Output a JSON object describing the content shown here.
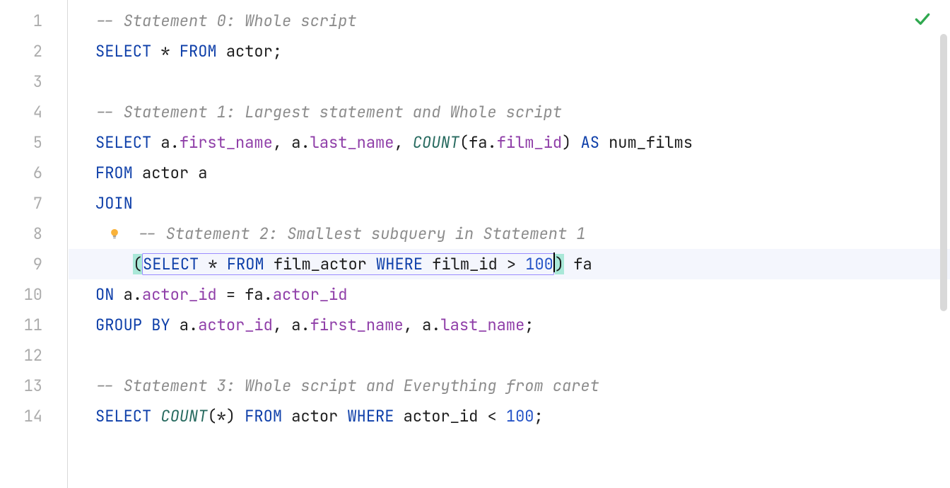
{
  "editor": {
    "line_numbers": [
      "1",
      "2",
      "3",
      "4",
      "5",
      "6",
      "7",
      "8",
      "9",
      "10",
      "11",
      "12",
      "13",
      "14"
    ],
    "highlighted_line_index": 8,
    "status_icon": "check-ok",
    "bulb_icon": "intention-bulb"
  },
  "code": {
    "l1_comment": "-- Statement 0: Whole script",
    "l2_select": "SELECT",
    "l2_star": " * ",
    "l2_from": "FROM",
    "l2_actor": " actor",
    "l2_semi": ";",
    "l4_comment": "-- Statement 1: Largest statement and Whole script",
    "l5_select": "SELECT",
    "l5_a1": " a",
    "l5_dot1": ".",
    "l5_first": "first_name",
    "l5_comma1": ", ",
    "l5_a2": "a",
    "l5_dot2": ".",
    "l5_last": "last_name",
    "l5_comma2": ", ",
    "l5_count": "COUNT",
    "l5_open": "(",
    "l5_fa": "fa",
    "l5_dot3": ".",
    "l5_film": "film_id",
    "l5_close": ")",
    "l5_as": " AS",
    "l5_num": " num_films",
    "l6_from": "FROM",
    "l6_actor": " actor a",
    "l7_join": "JOIN",
    "l8_comment": "-- Statement 2: Smallest subquery in Statement 1",
    "l9_indent": "    ",
    "l9_open": "(",
    "l9_select": "SELECT",
    "l9_star": " * ",
    "l9_from": "FROM",
    "l9_fa": " film_actor ",
    "l9_where": "WHERE",
    "l9_film": " film_id > ",
    "l9_num": "100",
    "l9_close": ")",
    "l9_alias": " fa",
    "l10_on": "ON",
    "l10_a": " a",
    "l10_dot1": ".",
    "l10_aid1": "actor_id",
    "l10_eq": " = ",
    "l10_fa": "fa",
    "l10_dot2": ".",
    "l10_aid2": "actor_id",
    "l11_group": "GROUP BY",
    "l11_a1": " a",
    "l11_dot1": ".",
    "l11_aid": "actor_id",
    "l11_c1": ", ",
    "l11_a2": "a",
    "l11_dot2": ".",
    "l11_first": "first_name",
    "l11_c2": ", ",
    "l11_a3": "a",
    "l11_dot3": ".",
    "l11_last": "last_name",
    "l11_semi": ";",
    "l13_comment": "-- Statement 3: Whole script and Everything from caret",
    "l14_select": "SELECT",
    "l14_sp1": " ",
    "l14_count": "COUNT",
    "l14_open": "(",
    "l14_star": "*",
    "l14_close": ")",
    "l14_sp2": " ",
    "l14_from": "FROM",
    "l14_actor": " actor ",
    "l14_where": "WHERE",
    "l14_aid": " actor_id < ",
    "l14_num": "100",
    "l14_semi": ";"
  }
}
